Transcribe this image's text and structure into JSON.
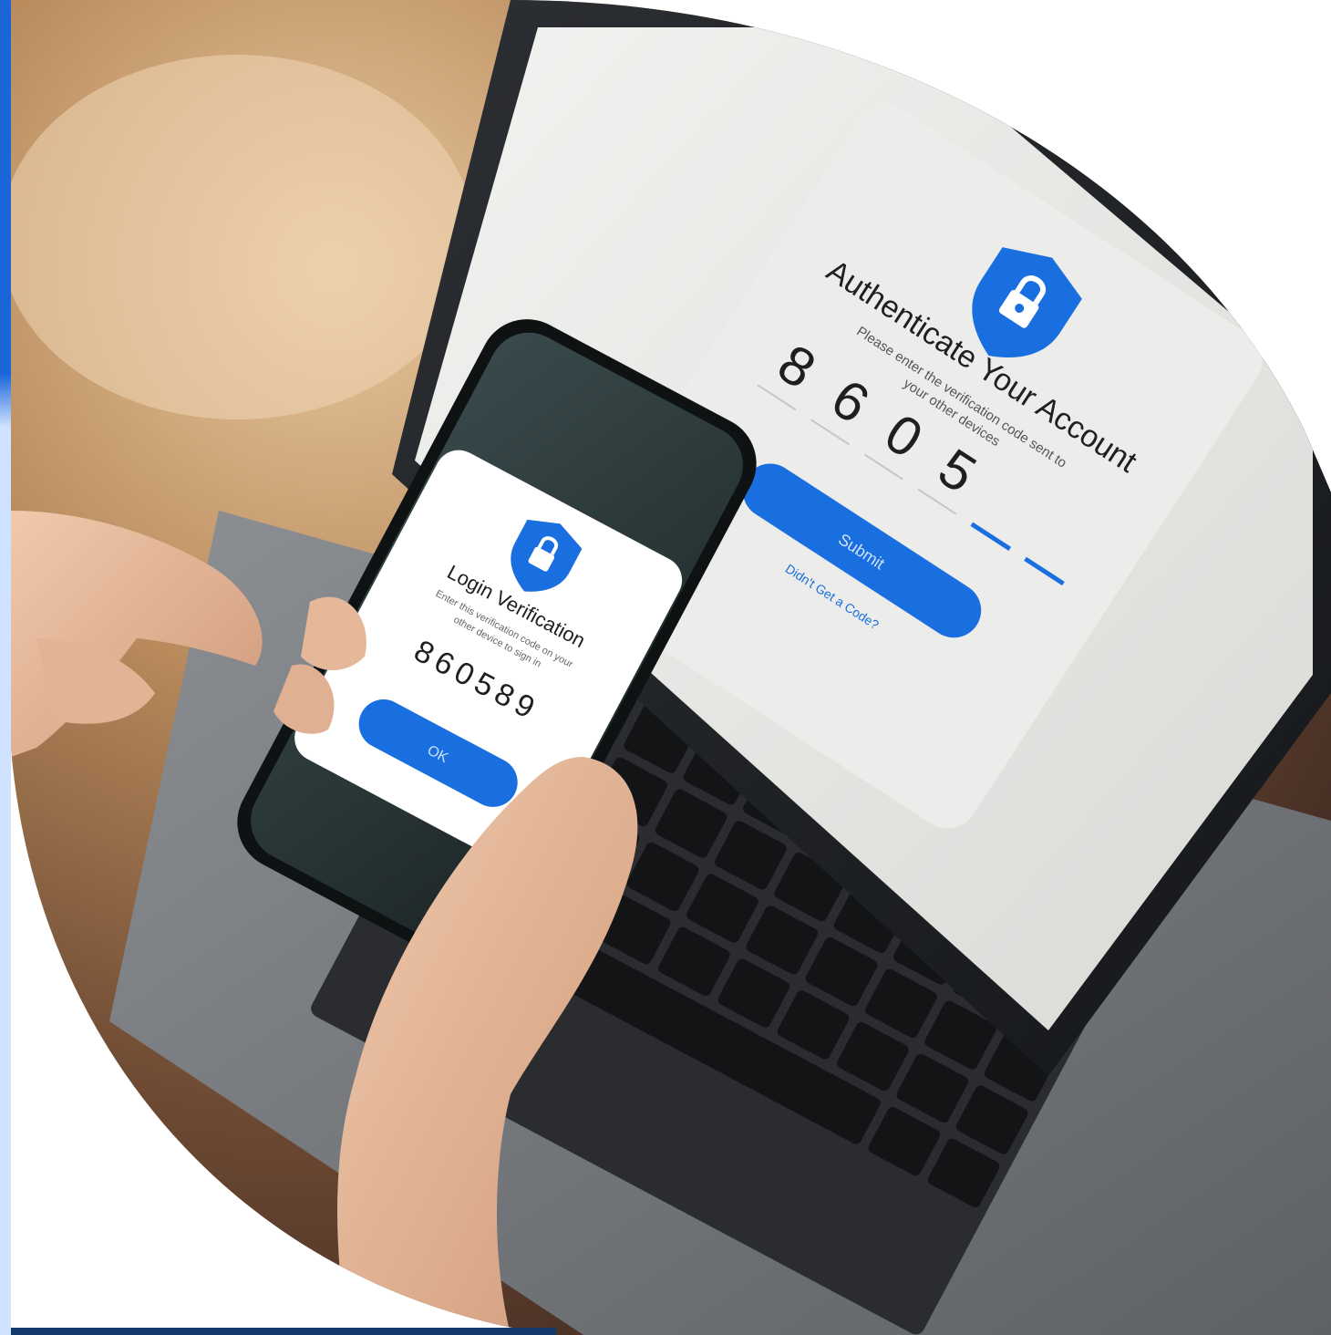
{
  "laptop_screen": {
    "title": "Authenticate Your Account",
    "subtitle_line1": "Please enter the verification code sent to",
    "subtitle_line2": "your other devices",
    "code_digits": [
      "8",
      "6",
      "0",
      "5"
    ],
    "submit_label": "Submit",
    "link_label": "Didn't Get a Code?"
  },
  "phone_screen": {
    "title": "Login Verification",
    "subtitle_line1": "Enter this verification code on your",
    "subtitle_line2": "other device to sign in",
    "code": "860589",
    "ok_label": "OK"
  },
  "colors": {
    "accent_blue": "#1a6fe0",
    "left_rail_blue": "#1a66d9",
    "left_rail_light": "#cfe2ff",
    "bottom_bar": "#123a6b"
  },
  "icons": [
    "shield-lock-icon"
  ]
}
